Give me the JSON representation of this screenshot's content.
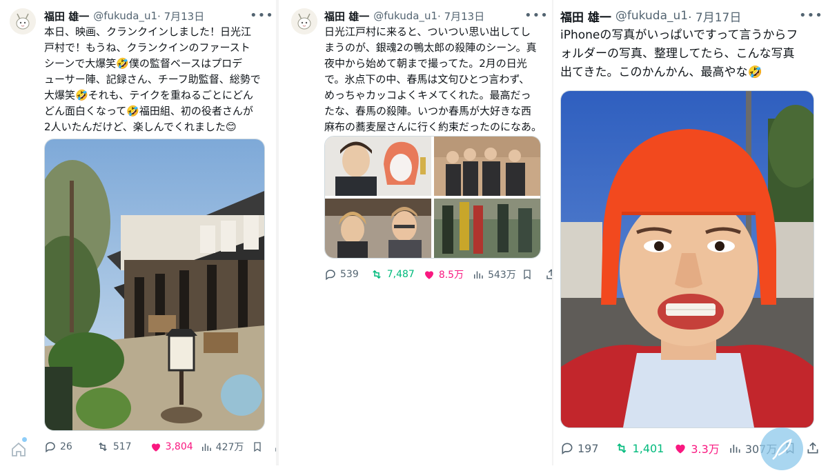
{
  "colors": {
    "text": "#0f1419",
    "muted": "#536471",
    "retweet": "#00ba7c",
    "like": "#f91880",
    "accent": "#1d9bf0"
  },
  "tweets": [
    {
      "author": "福田 雄一",
      "handle": "@fukuda_u1",
      "date": "· 7月13日",
      "text": "本日、映画、クランクインしました！日光江\n戸村で！もうね、クランクインのファースト\nシーンで大爆笑🤣僕の監督ベースはプロデ\nューサー陣、記録さん、チーフ助監督、総勢で\n大爆笑🤣それも、テイクを重ねるごとにどん\nどん面白くなって🤣福田組、初の役者さんが\n2人いたんだけど、楽しんでくれました😊",
      "media_icon": "edo-village-photo",
      "replies": "26",
      "retweets": "517",
      "likes": "3,804",
      "views": "427万"
    },
    {
      "author": "福田 雄一",
      "handle": "@fukuda_u1",
      "date": "· 7月13日",
      "text": "日光江戸村に来ると、ついつい思い出してし\nまうのが、銀魂2の鴨太郎の殺陣のシーン。真\n夜中から始めて朝まで撮ってた。2月の日光\nで。氷点下の中、春馬は文句ひとつ言わず、\nめっちゃカッコよくキメてくれた。最高だっ\nたな、春馬の殺陣。いつか春馬が大好きな西\n麻布の蕎麦屋さんに行く約束だったのになあ。",
      "media_icon": "photo-grid",
      "replies": "539",
      "retweets": "7,487",
      "likes": "8.5万",
      "views": "543万"
    },
    {
      "author": "福田 雄一",
      "handle": "@fukuda_u1",
      "date": "· 7月17日",
      "text": "iPhoneの写真がいっぱいですって言うからフ\nォルダーの写真、整理してたら、こんな写真\n出てきた。このかんかん、最高やな🤣",
      "media_icon": "portrait-photo",
      "replies": "197",
      "retweets": "1,401",
      "likes": "3.3万",
      "views": "307万"
    }
  ]
}
